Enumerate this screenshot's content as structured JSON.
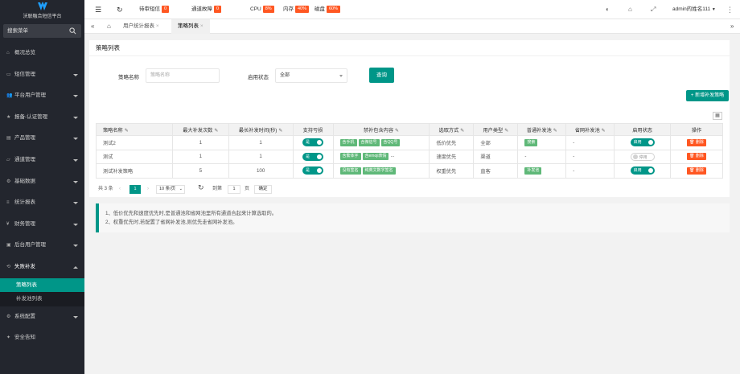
{
  "sidebar": {
    "logo_text": "沃联融合短信平台",
    "search_placeholder": "搜索菜单",
    "items": [
      {
        "label": "概况总览",
        "icon": "home-icon"
      },
      {
        "label": "短信管理",
        "icon": "message-icon"
      },
      {
        "label": "平台用户管理",
        "icon": "users-icon"
      },
      {
        "label": "报备-认证管理",
        "icon": "star-icon"
      },
      {
        "label": "产品管理",
        "icon": "file-icon"
      },
      {
        "label": "通道管理",
        "icon": "folder-icon"
      },
      {
        "label": "基础数据",
        "icon": "gear-icon"
      },
      {
        "label": "统计报表",
        "icon": "list-icon"
      },
      {
        "label": "财务管理",
        "icon": "money-icon"
      },
      {
        "label": "后台用户管理",
        "icon": "doc-icon"
      },
      {
        "label": "失败补发",
        "icon": "sync-icon"
      }
    ],
    "sub_items": [
      {
        "label": "策略列表",
        "active": true
      },
      {
        "label": "补发池列表",
        "active": false
      }
    ],
    "bottom_items": [
      {
        "label": "系统配置",
        "icon": "gear-icon"
      },
      {
        "label": "安全告知",
        "icon": "bulb-icon"
      }
    ]
  },
  "topbar": {
    "pending_sms_label": "待审短信",
    "pending_sms_value": "0",
    "channel_fault_label": "通道故障",
    "channel_fault_value": "0",
    "cpu_label": "CPU",
    "cpu_value": "8%",
    "memory_label": "内存",
    "memory_value": "40%",
    "disk_label": "磁盘",
    "disk_value": "60%",
    "user_name": "admin的姓名111"
  },
  "tabs": [
    {
      "label": "用户统计报表",
      "active": false
    },
    {
      "label": "策略列表",
      "active": true
    }
  ],
  "panel": {
    "title": "策略列表",
    "filter": {
      "name_label": "策略名称",
      "name_placeholder": "策略名称",
      "status_label": "启用状态",
      "status_value": "全部",
      "query_button": "查询"
    },
    "add_button": "新增补发策略"
  },
  "table": {
    "headers": [
      "策略名称",
      "最大补发次数",
      "最长补发时间(秒)",
      "支持亏损",
      "禁补包含内容",
      "选取方式",
      "用户类型",
      "普通补发池",
      "省网补发池",
      "启用状态",
      "操作"
    ],
    "rows": [
      {
        "name": "测试2",
        "max_count": "1",
        "max_time": "1",
        "loss": "是",
        "tags": [
          "含手机",
          "含微信号",
          "含QQ号"
        ],
        "tags_more": "",
        "mode": "低价优先",
        "user_type": "全部",
        "pool": "搜索",
        "prov_pool": "-",
        "status": "启用",
        "status_on": true,
        "op": "删除"
      },
      {
        "name": "测试",
        "max_count": "1",
        "max_time": "1",
        "loss": "是",
        "tags": [
          "含繁体字",
          "含emoji表情"
        ],
        "tags_more": "...",
        "mode": "速度优先",
        "user_type": "渠道",
        "pool": "-",
        "prov_pool": "-",
        "status": "停用",
        "status_on": false,
        "op": "删除"
      },
      {
        "name": "测试补发策略",
        "max_count": "5",
        "max_time": "100",
        "loss": "是",
        "tags": [
          "没有签名",
          "纯英文数字签名"
        ],
        "tags_more": "",
        "mode": "权重优先",
        "user_type": "直客",
        "pool": "补发池",
        "prov_pool": "-",
        "status": "启用",
        "status_on": true,
        "op": "删除"
      }
    ]
  },
  "pagination": {
    "total": "共 3 条",
    "current_page": "1",
    "page_size": "10 条/页",
    "goto_label": "到第",
    "goto_value": "1",
    "page_unit": "页",
    "confirm": "确定"
  },
  "notes": [
    "1、低价优先和速度优先时,是普通池和省网池里所有通道合起来计算选取的。",
    "2、权重优先时,若配置了省网补发池,则优先走省网补发池。"
  ]
}
